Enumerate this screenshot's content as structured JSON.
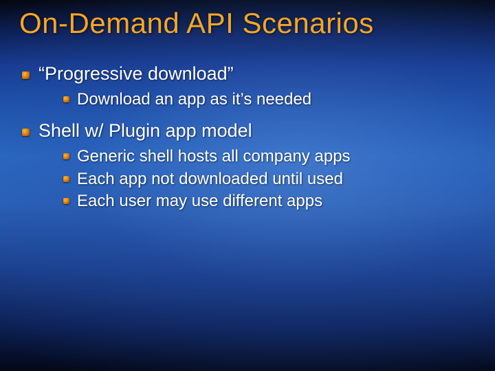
{
  "title": "On-Demand API Scenarios",
  "bullets": [
    {
      "text": "“Progressive download”",
      "children": [
        "Download an app as it’s needed"
      ]
    },
    {
      "text": "Shell w/ Plugin app model",
      "children": [
        "Generic shell hosts all company apps",
        "Each app not downloaded until used",
        "Each user may use different apps"
      ]
    }
  ]
}
